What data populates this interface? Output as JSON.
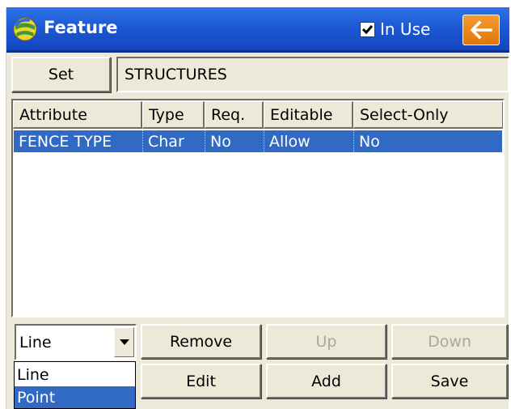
{
  "title_bar": {
    "title": "Feature",
    "in_use_label": "In Use",
    "in_use_checked": true,
    "back_icon": "arrow-left-icon",
    "app_icon": "globe-icon"
  },
  "set_row": {
    "set_button": "Set",
    "set_value": "STRUCTURES"
  },
  "table": {
    "columns": [
      "Attribute",
      "Type",
      "Req.",
      "Editable",
      "Select-Only"
    ],
    "rows": [
      [
        "FENCE TYPE",
        "Char",
        "No",
        "Allow",
        "No"
      ]
    ],
    "selected_row": 0
  },
  "geometry_combo": {
    "value": "Line",
    "options": [
      "Line",
      "Point"
    ],
    "highlighted_option": "Point"
  },
  "buttons": {
    "remove": "Remove",
    "up": "Up",
    "down": "Down",
    "edit": "Edit",
    "add": "Add",
    "save": "Save"
  },
  "colors": {
    "title_bar": "#1b57d2",
    "selection": "#316ac5",
    "back_button": "#e97d0f",
    "window_bg": "#ece9d8"
  }
}
